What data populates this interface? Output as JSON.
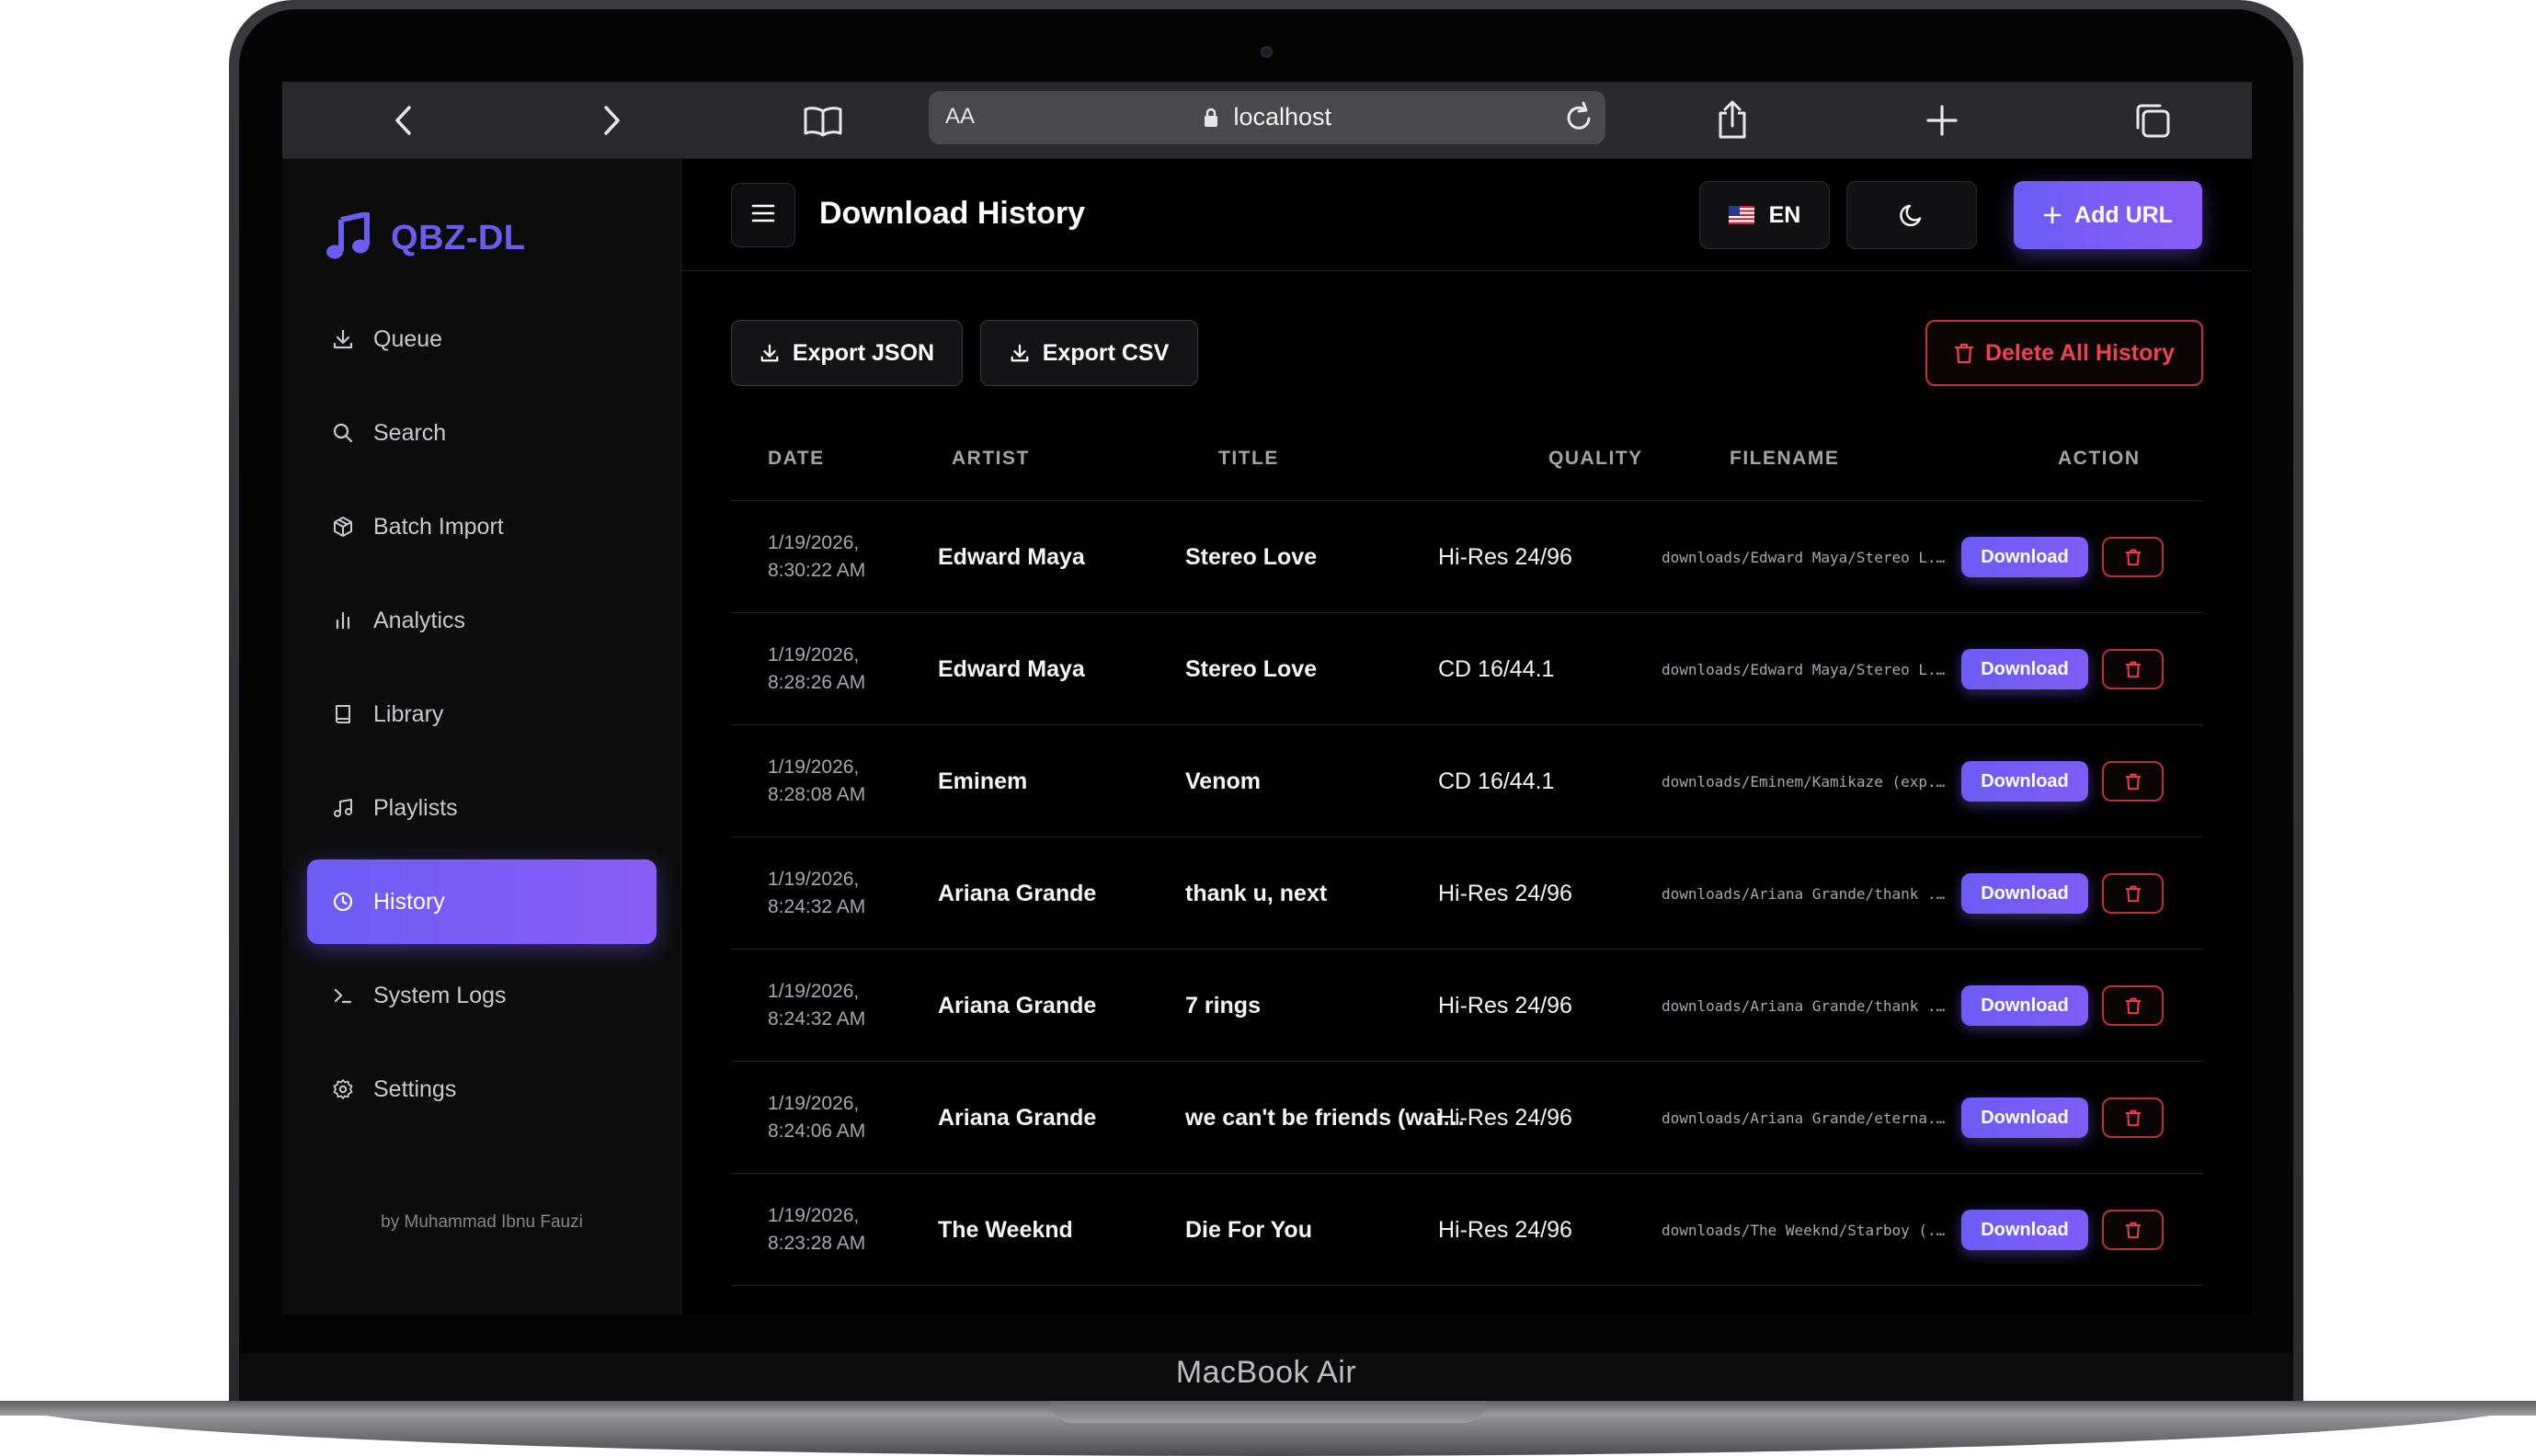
{
  "device": {
    "label": "MacBook Air"
  },
  "browser": {
    "aa_label": "AA",
    "url": "localhost"
  },
  "app": {
    "name": "QBZ-DL",
    "credit": "by Muhammad Ibnu Fauzi"
  },
  "sidebar": {
    "items": [
      {
        "label": "Queue",
        "icon": "download-icon",
        "active": false
      },
      {
        "label": "Search",
        "icon": "search-icon",
        "active": false
      },
      {
        "label": "Batch Import",
        "icon": "package-icon",
        "active": false
      },
      {
        "label": "Analytics",
        "icon": "bar-chart-icon",
        "active": false
      },
      {
        "label": "Library",
        "icon": "book-icon",
        "active": false
      },
      {
        "label": "Playlists",
        "icon": "music-note-icon",
        "active": false
      },
      {
        "label": "History",
        "icon": "clock-icon",
        "active": true
      },
      {
        "label": "System Logs",
        "icon": "terminal-icon",
        "active": false
      },
      {
        "label": "Settings",
        "icon": "gear-icon",
        "active": false
      }
    ]
  },
  "header": {
    "title": "Download History",
    "language": "EN",
    "add_url_label": "Add URL"
  },
  "actions": {
    "export_json": "Export JSON",
    "export_csv": "Export CSV",
    "delete_all": "Delete All History"
  },
  "table": {
    "columns": [
      "DATE",
      "ARTIST",
      "TITLE",
      "QUALITY",
      "FILENAME",
      "ACTION"
    ],
    "download_label": "Download",
    "rows": [
      {
        "date": "1/19/2026,",
        "time": "8:30:22 AM",
        "artist": "Edward Maya",
        "title": "Stereo Love",
        "quality": "Hi-Res 24/96",
        "filename": "downloads/Edward Maya/Stereo L..."
      },
      {
        "date": "1/19/2026,",
        "time": "8:28:26 AM",
        "artist": "Edward Maya",
        "title": "Stereo Love",
        "quality": "CD 16/44.1",
        "filename": "downloads/Edward Maya/Stereo L..."
      },
      {
        "date": "1/19/2026,",
        "time": "8:28:08 AM",
        "artist": "Eminem",
        "title": "Venom",
        "quality": "CD 16/44.1",
        "filename": "downloads/Eminem/Kamikaze (exp..."
      },
      {
        "date": "1/19/2026,",
        "time": "8:24:32 AM",
        "artist": "Ariana Grande",
        "title": "thank u, next",
        "quality": "Hi-Res 24/96",
        "filename": "downloads/Ariana Grande/thank ..."
      },
      {
        "date": "1/19/2026,",
        "time": "8:24:32 AM",
        "artist": "Ariana Grande",
        "title": "7 rings",
        "quality": "Hi-Res 24/96",
        "filename": "downloads/Ariana Grande/thank ..."
      },
      {
        "date": "1/19/2026,",
        "time": "8:24:06 AM",
        "artist": "Ariana Grande",
        "title": "we can't be friends (wait ...",
        "quality": "Hi-Res 24/96",
        "filename": "downloads/Ariana Grande/eterna..."
      },
      {
        "date": "1/19/2026,",
        "time": "8:23:28 AM",
        "artist": "The Weeknd",
        "title": "Die For You",
        "quality": "Hi-Res 24/96",
        "filename": "downloads/The Weeknd/Starboy (..."
      }
    ]
  },
  "colors": {
    "accent": "#6b5cf5",
    "accent_end": "#8a5cf6",
    "danger": "#f0424e",
    "background": "#000000",
    "sidebar_bg": "#0c0c0d"
  }
}
